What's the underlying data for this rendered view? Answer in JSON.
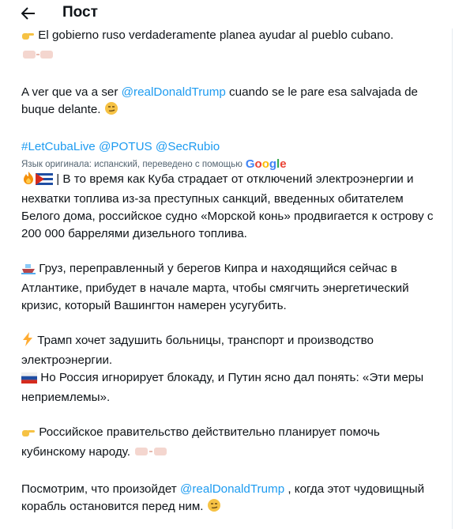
{
  "header": {
    "title": "Пост"
  },
  "original": {
    "line1": "El gobierno ruso verdaderamente planea ayudar al pueblo cubano.",
    "line2_prefix": "A ver que va a ser ",
    "mention": "@realDonaldTrump",
    "line2_suffix": " cuando se le pare esa salvajada de buque delante.",
    "hashtags": "#LetCubaLive @POTUS @SecRubio"
  },
  "translation_notice": {
    "text": "Язык оригинала: испанский, переведено с помощью",
    "brand": "Google"
  },
  "translated": {
    "para1": "| В то время как Куба страдает от отключений электроэнергии и нехватки топлива из-за преступных санкций, введенных обитателем Белого дома, российское судно «Морской конь» продвигается к острову с 200 000 баррелями дизельного топлива.",
    "para2": "Груз, переправленный у берегов Кипра и находящийся сейчас в Атлантике, прибудет в начале марта, чтобы смягчить энергетический кризис, который Вашингтон намерен усугубить.",
    "para3a": "Трамп хочет задушить больницы, транспорт и производство электроэнергии.",
    "para3b": "Но Россия игнорирует блокаду, и Путин ясно дал понять: «Эти меры неприемлемы».",
    "para4": "Российское правительство действительно планирует помочь кубинскому народу.",
    "para5_prefix": "Посмотрим, что произойдет ",
    "para5_mention": "@realDonaldTrump",
    "para5_suffix": " , когда этот чудовищный корабль остановится перед ним."
  },
  "icons": [
    "back-arrow-icon",
    "pointing-hand-icon",
    "fist-bump-icon",
    "smirk-face-icon",
    "fire-icon",
    "cuba-flag-icon",
    "ship-icon",
    "lightning-icon",
    "russia-flag-icon",
    "google-logo"
  ]
}
